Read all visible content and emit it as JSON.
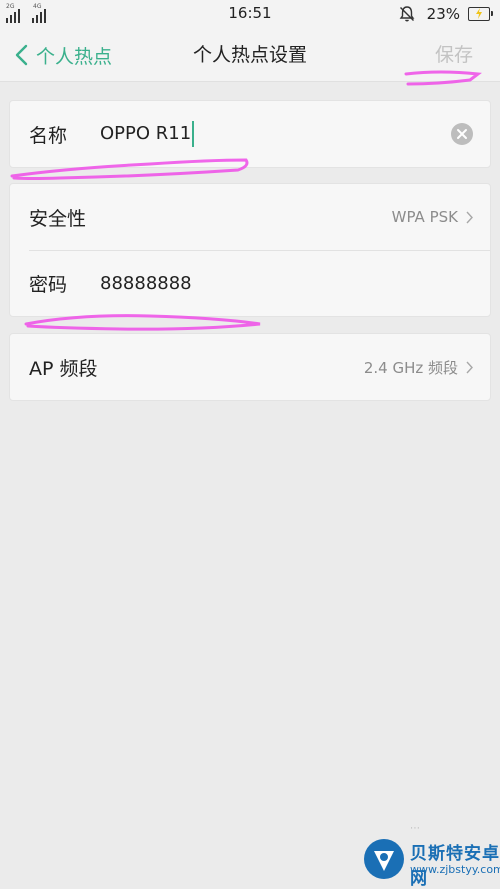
{
  "status_bar": {
    "network_tag_1": "2G",
    "network_tag_2": "4G",
    "time": "16:51",
    "battery_percent": "23%"
  },
  "nav": {
    "back_label": "个人热点",
    "title": "个人热点设置",
    "save_label": "保存"
  },
  "name_row": {
    "label": "名称",
    "value": "OPPO R11"
  },
  "security_row": {
    "label": "安全性",
    "value": "WPA PSK"
  },
  "password_row": {
    "label": "密码",
    "value": "88888888"
  },
  "band_row": {
    "label": "AP 频段",
    "value": "2.4 GHz 频段"
  },
  "watermark": {
    "title": "贝斯特安卓网",
    "url": "www.zjbstyy.com"
  },
  "colors": {
    "accent": "#3ab08c",
    "background": "#ebebeb",
    "card": "#f7f7f7",
    "save_disabled": "#c3c3c3",
    "secondary_text": "#8c8c8c",
    "highlight_mark": "#ee55e8"
  }
}
